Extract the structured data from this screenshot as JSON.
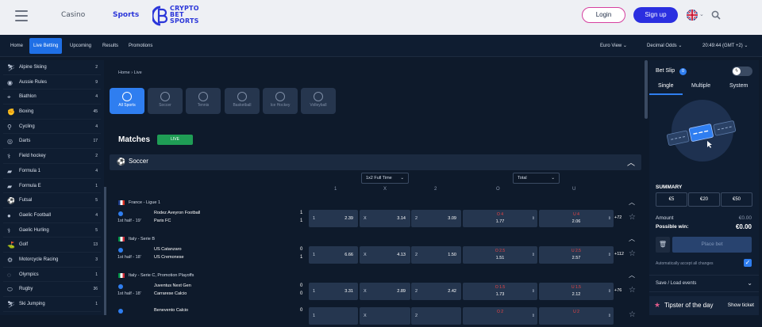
{
  "header": {
    "nav": [
      "Casino",
      "Sports"
    ],
    "logo_line1": "CRYPTO",
    "logo_line2": "BET",
    "logo_line3": "SPORTS",
    "login": "Login",
    "signup": "Sign up"
  },
  "subnav": {
    "items": [
      "Home",
      "Live Betting",
      "Upcoming",
      "Results",
      "Promotions"
    ],
    "view": "Euro View",
    "odds": "Decimal Odds",
    "time": "20:49:44 (GMT +2)"
  },
  "sidebar": {
    "items": [
      {
        "name": "Alpine Skiing",
        "count": "2",
        "icon": "⛷"
      },
      {
        "name": "Aussie Rules",
        "count": "9",
        "icon": "◉"
      },
      {
        "name": "Biathlon",
        "count": "4",
        "icon": "⌖"
      },
      {
        "name": "Boxing",
        "count": "45",
        "icon": "✊"
      },
      {
        "name": "Cycling",
        "count": "4",
        "icon": "⚲"
      },
      {
        "name": "Darts",
        "count": "17",
        "icon": "◎"
      },
      {
        "name": "Field hockey",
        "count": "2",
        "icon": "⚕"
      },
      {
        "name": "Formula 1",
        "count": "4",
        "icon": "▰"
      },
      {
        "name": "Formula E",
        "count": "1",
        "icon": "▰"
      },
      {
        "name": "Futsal",
        "count": "5",
        "icon": "⚽"
      },
      {
        "name": "Gaelic Football",
        "count": "4",
        "icon": "●"
      },
      {
        "name": "Gaelic Hurling",
        "count": "5",
        "icon": "⚕"
      },
      {
        "name": "Golf",
        "count": "13",
        "icon": "⛳"
      },
      {
        "name": "Motorcycle Racing",
        "count": "3",
        "icon": "⚙"
      },
      {
        "name": "Olympics",
        "count": "1",
        "icon": "◌"
      },
      {
        "name": "Rugby",
        "count": "36",
        "icon": "⬭"
      },
      {
        "name": "Ski Jumping",
        "count": "1",
        "icon": "⛷"
      }
    ]
  },
  "main": {
    "crumb_home": "Home",
    "crumb_sep": "›",
    "crumb_current": "Live",
    "sport_tiles": [
      "All Sports",
      "Soccer",
      "Tennis",
      "Basketball",
      "Ice Hockey",
      "Volleyball"
    ],
    "matches_title": "Matches",
    "live_badge": "LIVE",
    "section_title": "Soccer",
    "market_select": "1x2 Full Time",
    "total_select": "Total",
    "col_headers": [
      "1",
      "X",
      "2",
      "O",
      "U"
    ],
    "leagues": [
      {
        "name": "France - Ligue 1",
        "matches": [
          {
            "time": "1st half - 19'",
            "team1": "Rodez Aveyron Football",
            "team2": "Paris FC",
            "score1": "1",
            "score2": "1",
            "odd1": "2.39",
            "oddx": "3.14",
            "odd2": "3.09",
            "over_label": "O 4",
            "over": "1.77",
            "under_label": "U 4",
            "under": "2.06",
            "more": "+72"
          }
        ]
      },
      {
        "name": "Italy - Serie B",
        "matches": [
          {
            "time": "1st half - 18'",
            "team1": "US Catanzaro",
            "team2": "US Cremonese",
            "score1": "0",
            "score2": "1",
            "odd1": "6.66",
            "oddx": "4.13",
            "odd2": "1.50",
            "over_label": "O 2.5",
            "over": "1.51",
            "under_label": "U 2.5",
            "under": "2.57",
            "more": "+112"
          }
        ]
      },
      {
        "name": "Italy - Serie C, Promotion Playoffs",
        "matches": [
          {
            "time": "1st half - 18'",
            "team1": "Juventus Next Gen",
            "team2": "Carrarese Calcio",
            "score1": "0",
            "score2": "0",
            "odd1": "3.31",
            "oddx": "2.89",
            "odd2": "2.42",
            "over_label": "O 1.5",
            "over": "1.73",
            "under_label": "U 1.5",
            "under": "2.12",
            "more": "+76"
          },
          {
            "time": "",
            "team1": "Benevento Calcio",
            "team2": "",
            "score1": "0",
            "score2": "",
            "odd1": "",
            "oddx": "",
            "odd2": "",
            "over_label": "O 2",
            "over": "",
            "under_label": "U 2",
            "under": "",
            "more": ""
          }
        ]
      }
    ]
  },
  "betslip": {
    "title": "Bet Slip",
    "count": "0",
    "tabs": [
      "Single",
      "Multiple",
      "System"
    ],
    "summary": "SUMMARY",
    "stakes": [
      "€5",
      "€20",
      "€50"
    ],
    "amount_label": "Amount",
    "amount": "€0.00",
    "possible_label": "Possible win:",
    "possible": "€0.00",
    "place_bet": "Place bet",
    "auto_accept": "Automatically accept all changes",
    "save_load": "Save / Load events",
    "tipster": "Tipster of the day",
    "show_ticket": "Show ticket"
  },
  "colors": {
    "accent": "#2f7ef0",
    "live": "#1f9d55",
    "brand": "#2b2fe0",
    "login_border": "#d6409f"
  }
}
